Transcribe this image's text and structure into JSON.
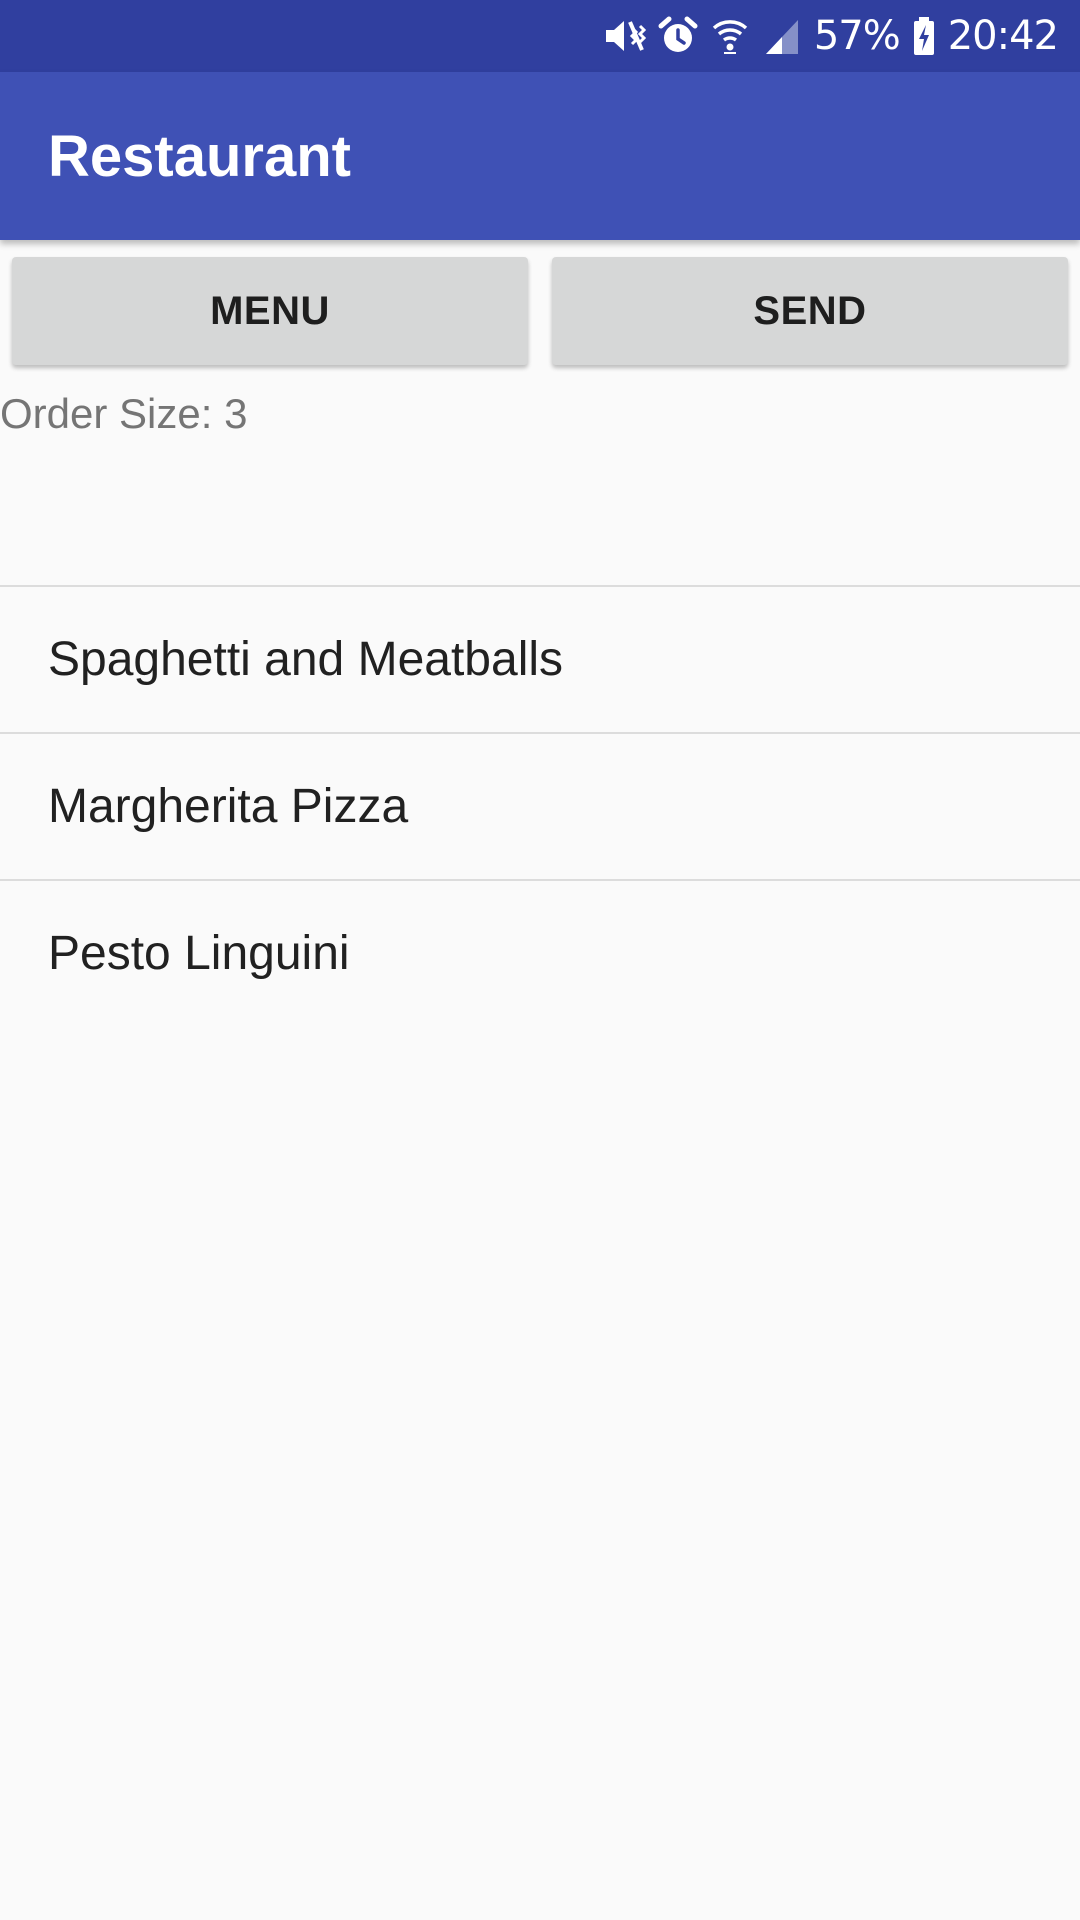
{
  "status_bar": {
    "icons": [
      "mute-vibrate-icon",
      "alarm-icon",
      "wifi-icon",
      "cell-signal-icon",
      "battery-charging-icon"
    ],
    "battery_percent": "57%",
    "time": "20:42"
  },
  "app_bar": {
    "title": "Restaurant",
    "color": "#3f51b5",
    "status_color": "#303f9f"
  },
  "buttons": {
    "menu_label": "MENU",
    "send_label": "SEND"
  },
  "order_size_label": "Order Size: 3",
  "order_items": [
    {
      "label": "Spaghetti and Meatballs"
    },
    {
      "label": "Margherita Pizza"
    },
    {
      "label": "Pesto Linguini"
    }
  ]
}
